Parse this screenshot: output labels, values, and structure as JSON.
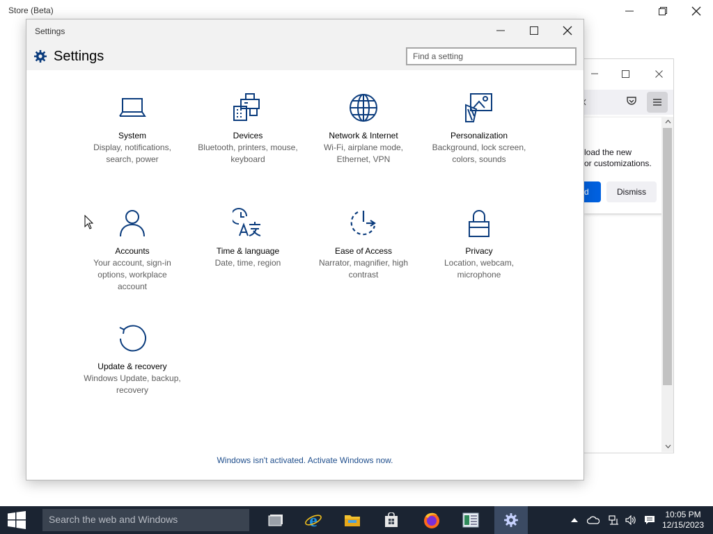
{
  "store_window": {
    "title": "Store (Beta)"
  },
  "firefox_window": {
    "popup_line1": "load the new",
    "popup_line2": "or customizations.",
    "primary_button_label": "d",
    "dismiss_label": "Dismiss"
  },
  "settings_window": {
    "titlebar_title": "Settings",
    "header_title": "Settings",
    "search_placeholder": "Find a setting",
    "tiles": [
      {
        "name": "System",
        "description": "Display, notifications, search, power",
        "icon": "laptop-icon"
      },
      {
        "name": "Devices",
        "description": "Bluetooth, printers, mouse, keyboard",
        "icon": "devices-icon"
      },
      {
        "name": "Network & Internet",
        "description": "Wi-Fi, airplane mode, Ethernet, VPN",
        "icon": "globe-icon"
      },
      {
        "name": "Personalization",
        "description": "Background, lock screen, colors, sounds",
        "icon": "personalization-icon"
      },
      {
        "name": "Accounts",
        "description": "Your account, sign-in options, workplace account",
        "icon": "person-icon"
      },
      {
        "name": "Time & language",
        "description": "Date, time, region",
        "icon": "time-language-icon"
      },
      {
        "name": "Ease of Access",
        "description": "Narrator, magnifier, high contrast",
        "icon": "ease-of-access-icon"
      },
      {
        "name": "Privacy",
        "description": "Location, webcam, microphone",
        "icon": "lock-icon"
      },
      {
        "name": "Update & recovery",
        "description": "Windows Update, backup, recovery",
        "icon": "update-icon"
      }
    ],
    "activation_link": "Windows isn't activated. Activate Windows now."
  },
  "taskbar": {
    "search_placeholder": "Search the web and Windows",
    "apps": [
      "task-view-icon",
      "internet-explorer-icon",
      "file-explorer-icon",
      "store-icon",
      "firefox-icon",
      "document-icon",
      "settings-icon"
    ],
    "clock": {
      "time": "10:05 PM",
      "date": "12/15/2023"
    }
  },
  "colors": {
    "icon_blue": "#0b3c7d",
    "taskbar": "#1b2432",
    "link": "#1f4e8c",
    "firefox_primary": "#0061e0"
  }
}
